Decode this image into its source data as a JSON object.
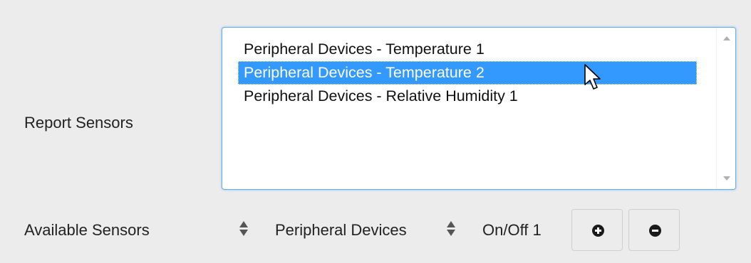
{
  "report_sensors": {
    "label": "Report Sensors",
    "options": [
      {
        "label": "Peripheral Devices - Temperature 1",
        "selected": false
      },
      {
        "label": "Peripheral Devices - Temperature 2",
        "selected": true
      },
      {
        "label": "Peripheral Devices - Relative Humidity 1",
        "selected": false
      }
    ]
  },
  "available_sensors": {
    "label": "Available Sensors",
    "device_select_value": "Peripheral Devices",
    "sensor_select_value": "On/Off 1",
    "add_icon": "plus-circle-icon",
    "remove_icon": "minus-circle-icon"
  },
  "colors": {
    "selection": "#3399ff",
    "focus_border": "#66aee8",
    "background": "#ececec"
  }
}
